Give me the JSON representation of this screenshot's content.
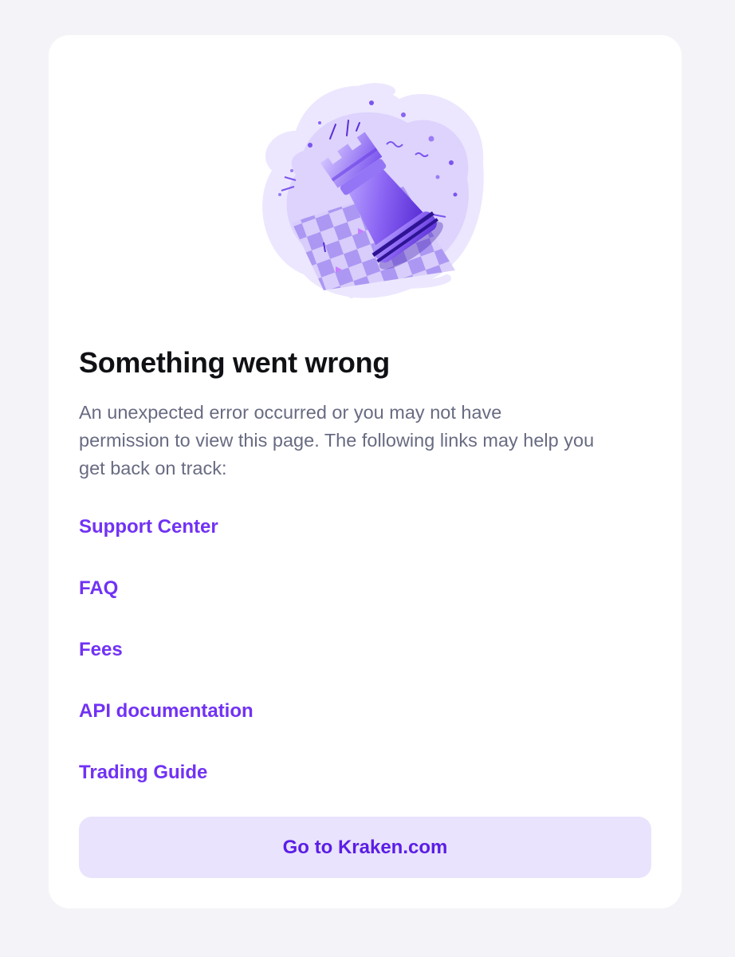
{
  "error": {
    "title": "Something went wrong",
    "description": "An unexpected error occurred or you may not have permission to view this page. The following links may help you get back on track:"
  },
  "illustration": {
    "icon": "chess-rook-icon"
  },
  "links": [
    {
      "label": "Support Center"
    },
    {
      "label": "FAQ"
    },
    {
      "label": "Fees"
    },
    {
      "label": "API documentation"
    },
    {
      "label": "Trading Guide"
    }
  ],
  "cta": {
    "label": "Go to Kraken.com"
  },
  "colors": {
    "accent": "#7132f5",
    "button_bg": "#e9e3fd",
    "page_bg": "#f4f4f8",
    "text_muted": "#686b82",
    "text_heading": "#101114"
  }
}
